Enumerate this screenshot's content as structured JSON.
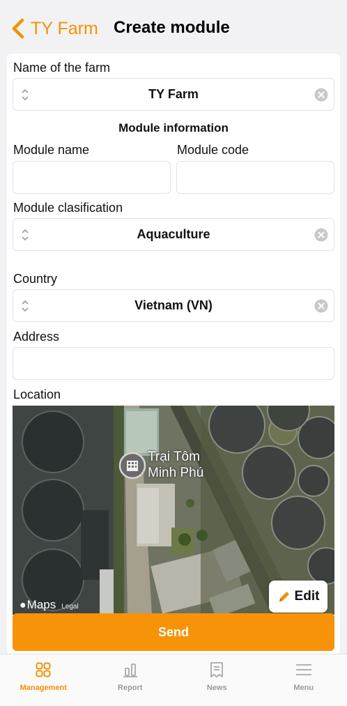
{
  "colors": {
    "accent": "#f39205",
    "send_button": "#f79309",
    "inactive_tab": "#9a9a9a"
  },
  "nav": {
    "back_label": "TY Farm",
    "back_icon": "chevron-left-icon",
    "title": "Create module"
  },
  "form": {
    "farm_label": "Name of the farm",
    "farm_value": "TY Farm",
    "section_title": "Module information",
    "module_name_label": "Module name",
    "module_name_value": "",
    "module_code_label": "Module code",
    "module_code_value": "",
    "classification_label": "Module clasification",
    "classification_value": "Aquaculture",
    "country_label": "Country",
    "country_value": "Vietnam (VN)",
    "address_label": "Address",
    "address_value": "",
    "location_label": "Location"
  },
  "map": {
    "place_line1": "Trại Tôm",
    "place_line2": "Minh Phú",
    "provider": "Maps",
    "legal": "Legal",
    "edit_label": "Edit"
  },
  "send_label": "Send",
  "tabs": [
    {
      "label": "Management",
      "icon": "grid-icon",
      "active": true
    },
    {
      "label": "Report",
      "icon": "bar-chart-icon",
      "active": false
    },
    {
      "label": "News",
      "icon": "news-icon",
      "active": false
    },
    {
      "label": "Menu",
      "icon": "menu-icon",
      "active": false
    }
  ]
}
